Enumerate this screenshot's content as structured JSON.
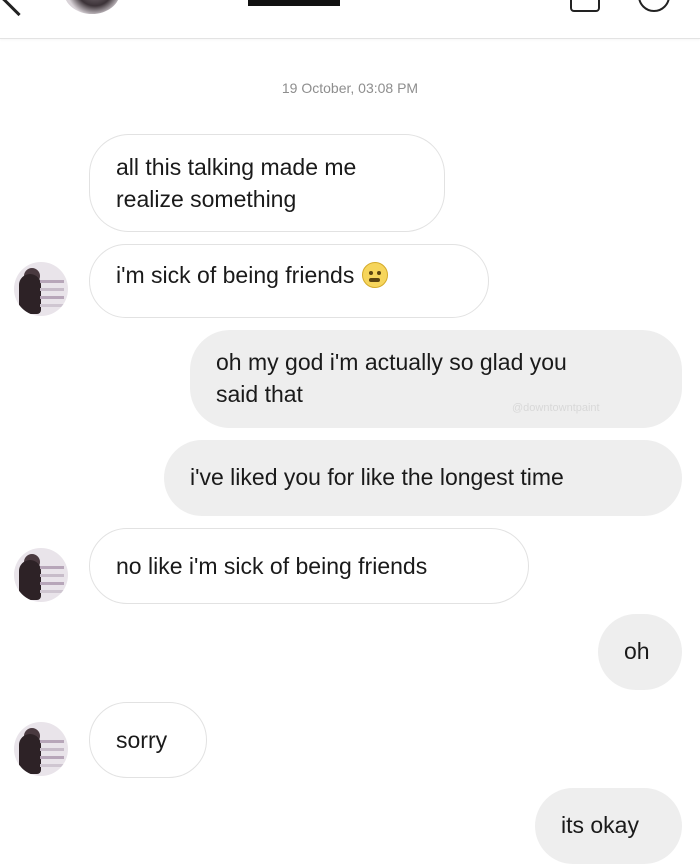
{
  "timestamp": "19 October, 03:08 PM",
  "watermark": "@downtowntpaint",
  "messages": {
    "m1_line1": "all this talking made me",
    "m1_line2": "realize something",
    "m2": "i'm sick of being friends",
    "m3_line1": "oh my god i'm actually so glad you",
    "m3_line2": "said that",
    "m4": "i've liked you for like the longest time",
    "m5": "no like i'm sick of being friends",
    "m6": "oh",
    "m7": "sorry",
    "m8": "its okay"
  },
  "icons": {
    "back": "chevron-left-icon",
    "video": "video-call-icon",
    "info": "info-icon",
    "emoji": "grimacing-face-icon"
  },
  "colors": {
    "incoming_bubble": "#ffffff",
    "outgoing_bubble": "#eeeeee",
    "timestamp_text": "#8e8e8e"
  }
}
